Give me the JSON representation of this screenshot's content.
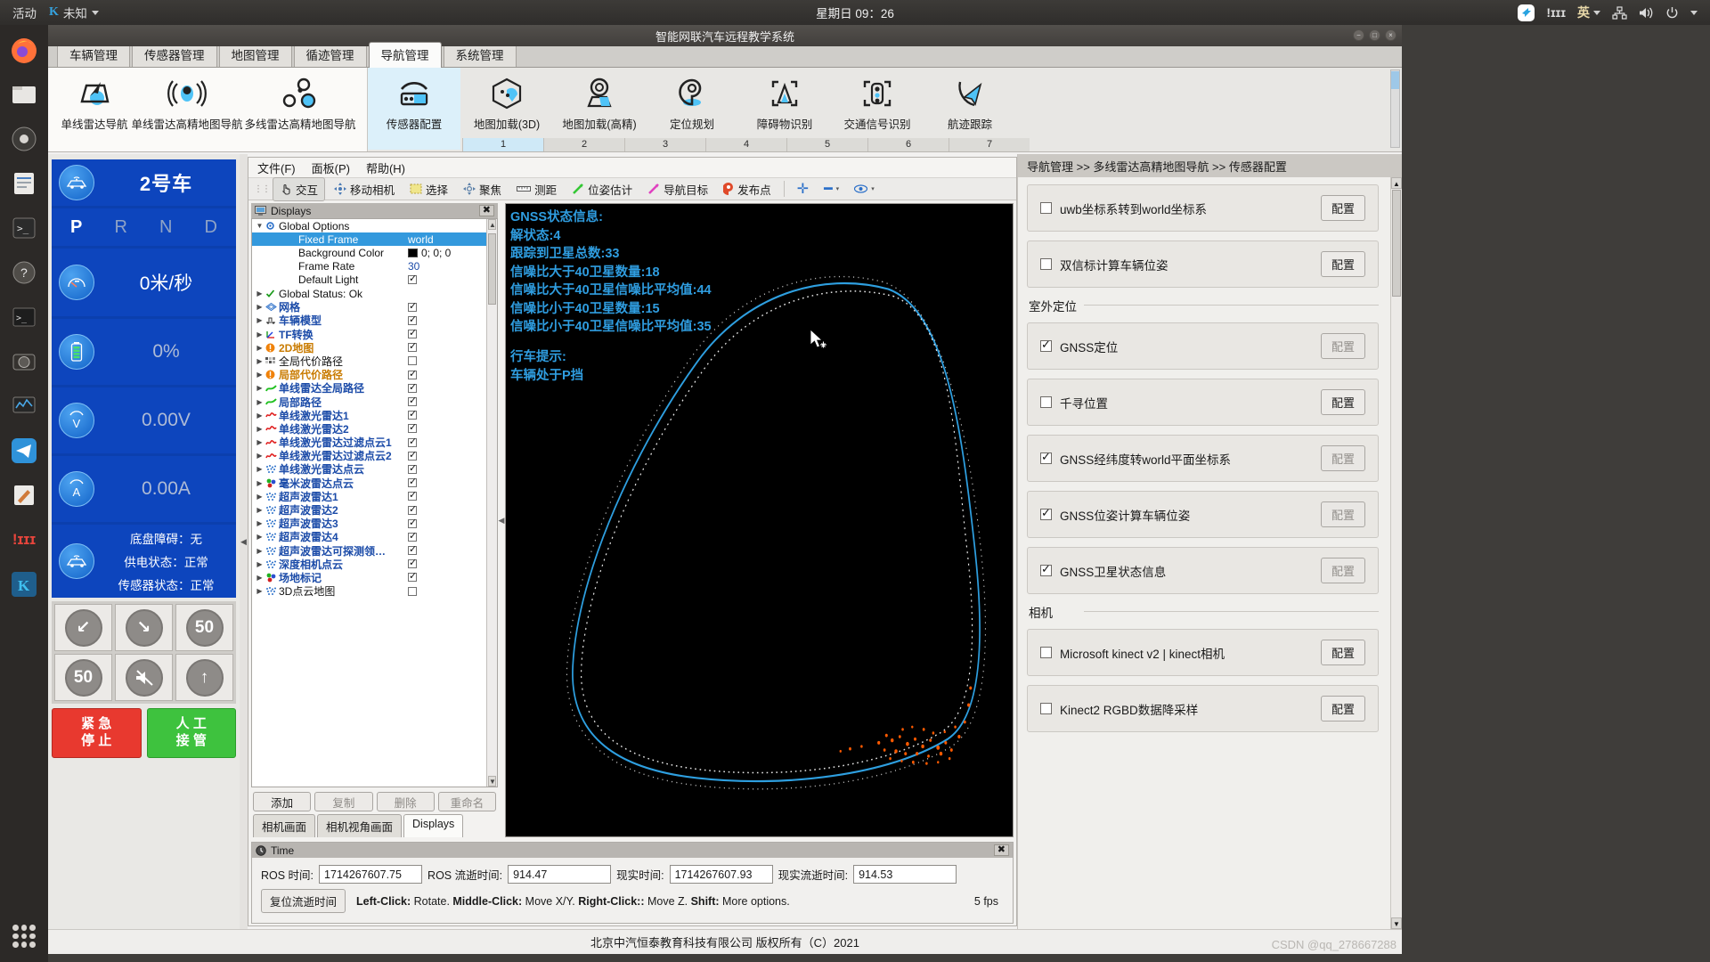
{
  "gnome": {
    "activities": "活动",
    "ime_app": "未知",
    "clock": "星期日 09：26",
    "lang": "英",
    "icons": [
      "tray-app-icon",
      "ibus-icon",
      "language-icon",
      "network-icon",
      "volume-icon",
      "power-icon"
    ]
  },
  "dock": {
    "items": [
      "firefox-icon",
      "files-icon",
      "settings-icon",
      "text-editor-icon",
      "terminal-icon",
      "help-icon",
      "terminal2-icon",
      "camera-icon",
      "monitor-icon",
      "telegram-icon",
      "editor-icon",
      "ibus-icon",
      "kdevelop-icon"
    ],
    "show_apps": "show-applications-icon"
  },
  "window": {
    "title": "智能网联汽车远程教学系统",
    "minimize": "−",
    "maximize": "□",
    "close": "×"
  },
  "tabs": [
    {
      "label": "车辆管理",
      "active": false
    },
    {
      "label": "传感器管理",
      "active": false
    },
    {
      "label": "地图管理",
      "active": false
    },
    {
      "label": "循迹管理",
      "active": false
    },
    {
      "label": "导航管理",
      "active": true
    },
    {
      "label": "系统管理",
      "active": false
    }
  ],
  "ribbon": {
    "left_group": [
      {
        "label": "单线雷达导航",
        "icon": "map-arrow-icon"
      },
      {
        "label": "单线雷达高精地图导航",
        "icon": "signal-pin-icon"
      },
      {
        "label": "多线雷达高精地图导航",
        "icon": "multi-dot-icon"
      }
    ],
    "right_group": [
      {
        "label": "传感器配置",
        "num": "1",
        "icon": "sensor-config-icon",
        "selected": true
      },
      {
        "label": "地图加载(3D)",
        "num": "2",
        "icon": "map-3d-icon",
        "selected": false
      },
      {
        "label": "地图加载(高精)",
        "num": "3",
        "icon": "map-hd-icon",
        "selected": false
      },
      {
        "label": "定位规划",
        "num": "4",
        "icon": "location-pin-icon",
        "selected": false
      },
      {
        "label": "障碍物识别",
        "num": "5",
        "icon": "obstacle-icon",
        "selected": false
      },
      {
        "label": "交通信号识别",
        "num": "6",
        "icon": "traffic-light-icon",
        "selected": false
      },
      {
        "label": "航迹跟踪",
        "num": "7",
        "icon": "track-icon",
        "selected": false
      }
    ]
  },
  "hud": {
    "vehicle_name": "2号车",
    "vehicle_icon": "car-wifi-icon",
    "gears": [
      {
        "label": "P",
        "active": true
      },
      {
        "label": "R",
        "active": false
      },
      {
        "label": "N",
        "active": false
      },
      {
        "label": "D",
        "active": false
      }
    ],
    "speed": "0米/秒",
    "speed_icon": "gauge-icon",
    "battery": "0%",
    "battery_icon": "battery-icon",
    "voltage": "0.00V",
    "voltage_icon": "volt-icon",
    "current": "0.00A",
    "current_icon": "amp-icon",
    "status_icon": "car-wifi-icon",
    "status_lines": [
      "底盘障碍：无",
      "供电状态：正常",
      "传感器状态：正常"
    ],
    "controls": [
      {
        "name": "turn-left-down-icon",
        "glyph": "↙"
      },
      {
        "name": "turn-right-down-icon",
        "glyph": "↘"
      },
      {
        "name": "speed-50-icon",
        "glyph": "50"
      },
      {
        "name": "speed-50b-icon",
        "glyph": "50"
      },
      {
        "name": "no-horn-icon",
        "glyph": "🔇"
      },
      {
        "name": "forward-icon",
        "glyph": "↑"
      }
    ],
    "emergency_stop": [
      "紧 急",
      "停 止"
    ],
    "manual_takeover": [
      "人 工",
      "接 管"
    ]
  },
  "rviz": {
    "menus": [
      {
        "label": "文件(F)",
        "key": "F"
      },
      {
        "label": "面板(P)",
        "key": "P"
      },
      {
        "label": "帮助(H)",
        "key": "H"
      }
    ],
    "tools": [
      {
        "label": "交互",
        "icon": "hand-icon",
        "active": true
      },
      {
        "label": "移动相机",
        "icon": "move-camera-icon",
        "active": false
      },
      {
        "label": "选择",
        "icon": "select-icon",
        "active": false
      },
      {
        "label": "聚焦",
        "icon": "focus-icon",
        "active": false
      },
      {
        "label": "测距",
        "icon": "measure-icon",
        "active": false
      },
      {
        "label": "位姿估计",
        "icon": "pose-estimate-icon",
        "active": false
      },
      {
        "label": "导航目标",
        "icon": "nav-goal-icon",
        "active": false
      },
      {
        "label": "发布点",
        "icon": "publish-point-icon",
        "active": false
      }
    ],
    "extra_tools": [
      "plus-icon",
      "minus-icon",
      "eye-icon"
    ],
    "displays_title": "Displays",
    "displays_close": "✖",
    "tree": [
      {
        "arrow": "▼",
        "icon": "gear-icon",
        "name": "Global Options",
        "color": "black",
        "indent": 0,
        "value": "",
        "check": null,
        "selected": false
      },
      {
        "arrow": "",
        "icon": "",
        "name": "Fixed Frame",
        "color": "black",
        "indent": 1,
        "value": "world",
        "check": null,
        "selected": true
      },
      {
        "arrow": "",
        "icon": "",
        "name": "Background Color",
        "color": "black",
        "indent": 1,
        "value": "0; 0; 0",
        "check": null,
        "selected": false,
        "swatch": "#000000"
      },
      {
        "arrow": "",
        "icon": "",
        "name": "Frame Rate",
        "color": "black",
        "indent": 1,
        "value": "30",
        "check": null,
        "selected": false
      },
      {
        "arrow": "",
        "icon": "",
        "name": "Default Light",
        "color": "black",
        "indent": 1,
        "value": "",
        "check": true,
        "selected": false
      },
      {
        "arrow": "▶",
        "icon": "check-icon",
        "name": "Global Status: Ok",
        "color": "black",
        "indent": 0,
        "value": "",
        "check": null,
        "selected": false
      },
      {
        "arrow": "▶",
        "icon": "grid-icon",
        "name": "网格",
        "color": "blue",
        "indent": 0,
        "value": "",
        "check": true,
        "selected": false
      },
      {
        "arrow": "▶",
        "icon": "robot-icon",
        "name": "车辆模型",
        "color": "blue",
        "indent": 0,
        "value": "",
        "check": true,
        "selected": false
      },
      {
        "arrow": "▶",
        "icon": "tf-icon",
        "name": "TF转换",
        "color": "blue",
        "indent": 0,
        "value": "",
        "check": true,
        "selected": false
      },
      {
        "arrow": "▶",
        "icon": "map-warn-icon",
        "name": "2D地图",
        "color": "orange",
        "indent": 0,
        "value": "",
        "check": true,
        "selected": false
      },
      {
        "arrow": "▶",
        "icon": "costmap-icon",
        "name": "全局代价路径",
        "color": "black",
        "indent": 0,
        "value": "",
        "check": false,
        "selected": false
      },
      {
        "arrow": "▶",
        "icon": "map-warn-icon",
        "name": "局部代价路径",
        "color": "orange",
        "indent": 0,
        "value": "",
        "check": true,
        "selected": false
      },
      {
        "arrow": "▶",
        "icon": "path-icon",
        "name": "单线雷达全局路径",
        "color": "blue",
        "indent": 0,
        "value": "",
        "check": true,
        "selected": false
      },
      {
        "arrow": "▶",
        "icon": "path-icon",
        "name": "局部路径",
        "color": "blue",
        "indent": 0,
        "value": "",
        "check": true,
        "selected": false
      },
      {
        "arrow": "▶",
        "icon": "laser-icon",
        "name": "单线激光雷达1",
        "color": "blue",
        "indent": 0,
        "value": "",
        "check": true,
        "selected": false
      },
      {
        "arrow": "▶",
        "icon": "laser-icon",
        "name": "单线激光雷达2",
        "color": "blue",
        "indent": 0,
        "value": "",
        "check": true,
        "selected": false
      },
      {
        "arrow": "▶",
        "icon": "laser-icon",
        "name": "单线激光雷达过滤点云1",
        "color": "blue",
        "indent": 0,
        "value": "",
        "check": true,
        "selected": false
      },
      {
        "arrow": "▶",
        "icon": "laser-icon",
        "name": "单线激光雷达过滤点云2",
        "color": "blue",
        "indent": 0,
        "value": "",
        "check": true,
        "selected": false
      },
      {
        "arrow": "▶",
        "icon": "pointcloud-icon",
        "name": "单线激光雷达点云",
        "color": "blue",
        "indent": 0,
        "value": "",
        "check": true,
        "selected": false
      },
      {
        "arrow": "▶",
        "icon": "marker-icon",
        "name": "毫米波雷达点云",
        "color": "blue",
        "indent": 0,
        "value": "",
        "check": true,
        "selected": false
      },
      {
        "arrow": "▶",
        "icon": "pointcloud-icon",
        "name": "超声波雷达1",
        "color": "blue",
        "indent": 0,
        "value": "",
        "check": true,
        "selected": false
      },
      {
        "arrow": "▶",
        "icon": "pointcloud-icon",
        "name": "超声波雷达2",
        "color": "blue",
        "indent": 0,
        "value": "",
        "check": true,
        "selected": false
      },
      {
        "arrow": "▶",
        "icon": "pointcloud-icon",
        "name": "超声波雷达3",
        "color": "blue",
        "indent": 0,
        "value": "",
        "check": true,
        "selected": false
      },
      {
        "arrow": "▶",
        "icon": "pointcloud-icon",
        "name": "超声波雷达4",
        "color": "blue",
        "indent": 0,
        "value": "",
        "check": true,
        "selected": false
      },
      {
        "arrow": "▶",
        "icon": "pointcloud-icon",
        "name": "超声波雷达可探测领…",
        "color": "blue",
        "indent": 0,
        "value": "",
        "check": true,
        "selected": false
      },
      {
        "arrow": "▶",
        "icon": "pointcloud-icon",
        "name": "深度相机点云",
        "color": "blue",
        "indent": 0,
        "value": "",
        "check": true,
        "selected": false
      },
      {
        "arrow": "▶",
        "icon": "marker-icon",
        "name": "场地标记",
        "color": "blue",
        "indent": 0,
        "value": "",
        "check": true,
        "selected": false
      },
      {
        "arrow": "▶",
        "icon": "pointcloud-icon",
        "name": "3D点云地图",
        "color": "black",
        "indent": 0,
        "value": "",
        "check": false,
        "selected": false
      }
    ],
    "tree_buttons": [
      {
        "label": "添加",
        "disabled": false
      },
      {
        "label": "复制",
        "disabled": true
      },
      {
        "label": "删除",
        "disabled": true
      },
      {
        "label": "重命名",
        "disabled": true
      }
    ],
    "bottom_tabs": [
      {
        "label": "相机画面",
        "active": false
      },
      {
        "label": "相机视角画面",
        "active": false
      },
      {
        "label": "Displays",
        "active": true
      }
    ],
    "overlay": {
      "lines": [
        "GNSS状态信息:",
        "解状态:4",
        "跟踪到卫星总数:33",
        "信噪比大于40卫星数量:18",
        "信噪比大于40卫星信噪比平均值:44",
        "信噪比小于40卫星数量:15",
        "信噪比小于40卫星信噪比平均值:35"
      ],
      "lines2": [
        "行车提示:",
        "车辆处于P挡"
      ],
      "color": "#2f9de0"
    },
    "time": {
      "title": "Time",
      "icon": "clock-icon",
      "close": "✖",
      "fields": [
        {
          "label": "ROS 时间:",
          "value": "1714267607.75"
        },
        {
          "label": "ROS 流逝时间:",
          "value": "914.47"
        },
        {
          "label": "现实时间:",
          "value": "1714267607.93"
        },
        {
          "label": "现实流逝时间:",
          "value": "914.53"
        }
      ],
      "reset_button": "复位流逝时间",
      "hint_bold": [
        "Left-Click:",
        "Middle-Click:",
        "Right-Click:",
        "Shift:"
      ],
      "hint_text": "Left-Click: Rotate. Middle-Click: Move X/Y. Right-Click:: Move Z. Shift: More options.",
      "fps": "5 fps"
    }
  },
  "config": {
    "breadcrumb": "导航管理 >> 多线雷达高精地图导航 >> 传感器配置",
    "items": [
      {
        "label": "uwb坐标系转到world坐标系",
        "checked": false,
        "button": "配置",
        "button_disabled": false,
        "section": null
      },
      {
        "label": "双信标计算车辆位姿",
        "checked": false,
        "button": "配置",
        "button_disabled": false,
        "section": null
      }
    ],
    "sections": [
      {
        "title": "室外定位",
        "items": [
          {
            "label": "GNSS定位",
            "checked": true,
            "button": "配置",
            "button_disabled": true
          },
          {
            "label": "千寻位置",
            "checked": false,
            "button": "配置",
            "button_disabled": false
          },
          {
            "label": "GNSS经纬度转world平面坐标系",
            "checked": true,
            "button": "配置",
            "button_disabled": true
          },
          {
            "label": "GNSS位姿计算车辆位姿",
            "checked": true,
            "button": "配置",
            "button_disabled": true
          },
          {
            "label": "GNSS卫星状态信息",
            "checked": true,
            "button": "配置",
            "button_disabled": true
          }
        ]
      },
      {
        "title": "相机",
        "items": [
          {
            "label": "Microsoft kinect v2 | kinect相机",
            "checked": false,
            "button": "配置",
            "button_disabled": false
          },
          {
            "label": "Kinect2 RGBD数据降采样",
            "checked": false,
            "button": "配置",
            "button_disabled": false
          }
        ]
      }
    ]
  },
  "statusbar": {
    "text": "北京中汽恒泰教育科技有限公司 版权所有（C）2021"
  },
  "watermark": "CSDN @qq_278667288",
  "colors": {
    "hud_blue": "#0d45bd",
    "accent_cyan": "#2f9de0",
    "emergency_red": "#e8392f",
    "manual_green": "#3ec23e",
    "tree_blue": "#1b4ba8",
    "tree_orange": "#c97b00"
  }
}
